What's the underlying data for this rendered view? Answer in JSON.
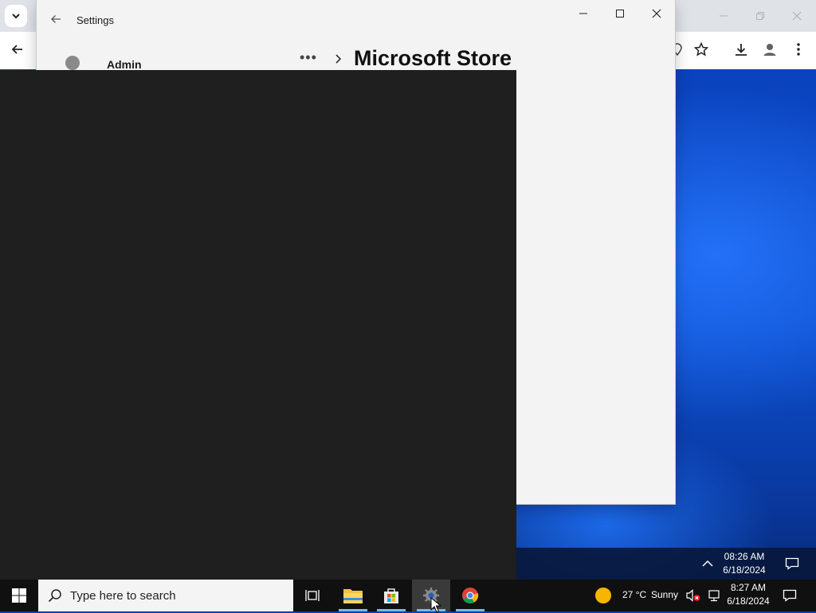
{
  "desktop": {
    "accent": "#0a3fb0"
  },
  "chrome": {
    "tab_search_icon": "chevron-down-icon",
    "toolbar_icons": [
      "back-arrow-icon",
      "location-pin-icon",
      "star-icon",
      "download-icon",
      "profile-icon",
      "more-vert-icon"
    ]
  },
  "settings": {
    "window_title": "Settings",
    "user_name": "Admin",
    "breadcrumb_more": "•••",
    "page_title": "Microsoft Store"
  },
  "taskbar": {
    "search_placeholder": "Type here to search",
    "apps": [
      "task-view-icon",
      "file-explorer-icon",
      "microsoft-store-icon",
      "settings-gear-icon",
      "chrome-icon"
    ],
    "weather_temp": "27 °C",
    "weather_desc": "Sunny",
    "time": "8:27 AM",
    "date": "6/18/2024"
  },
  "secondary_tray": {
    "time": "08:26 AM",
    "date": "6/18/2024"
  }
}
